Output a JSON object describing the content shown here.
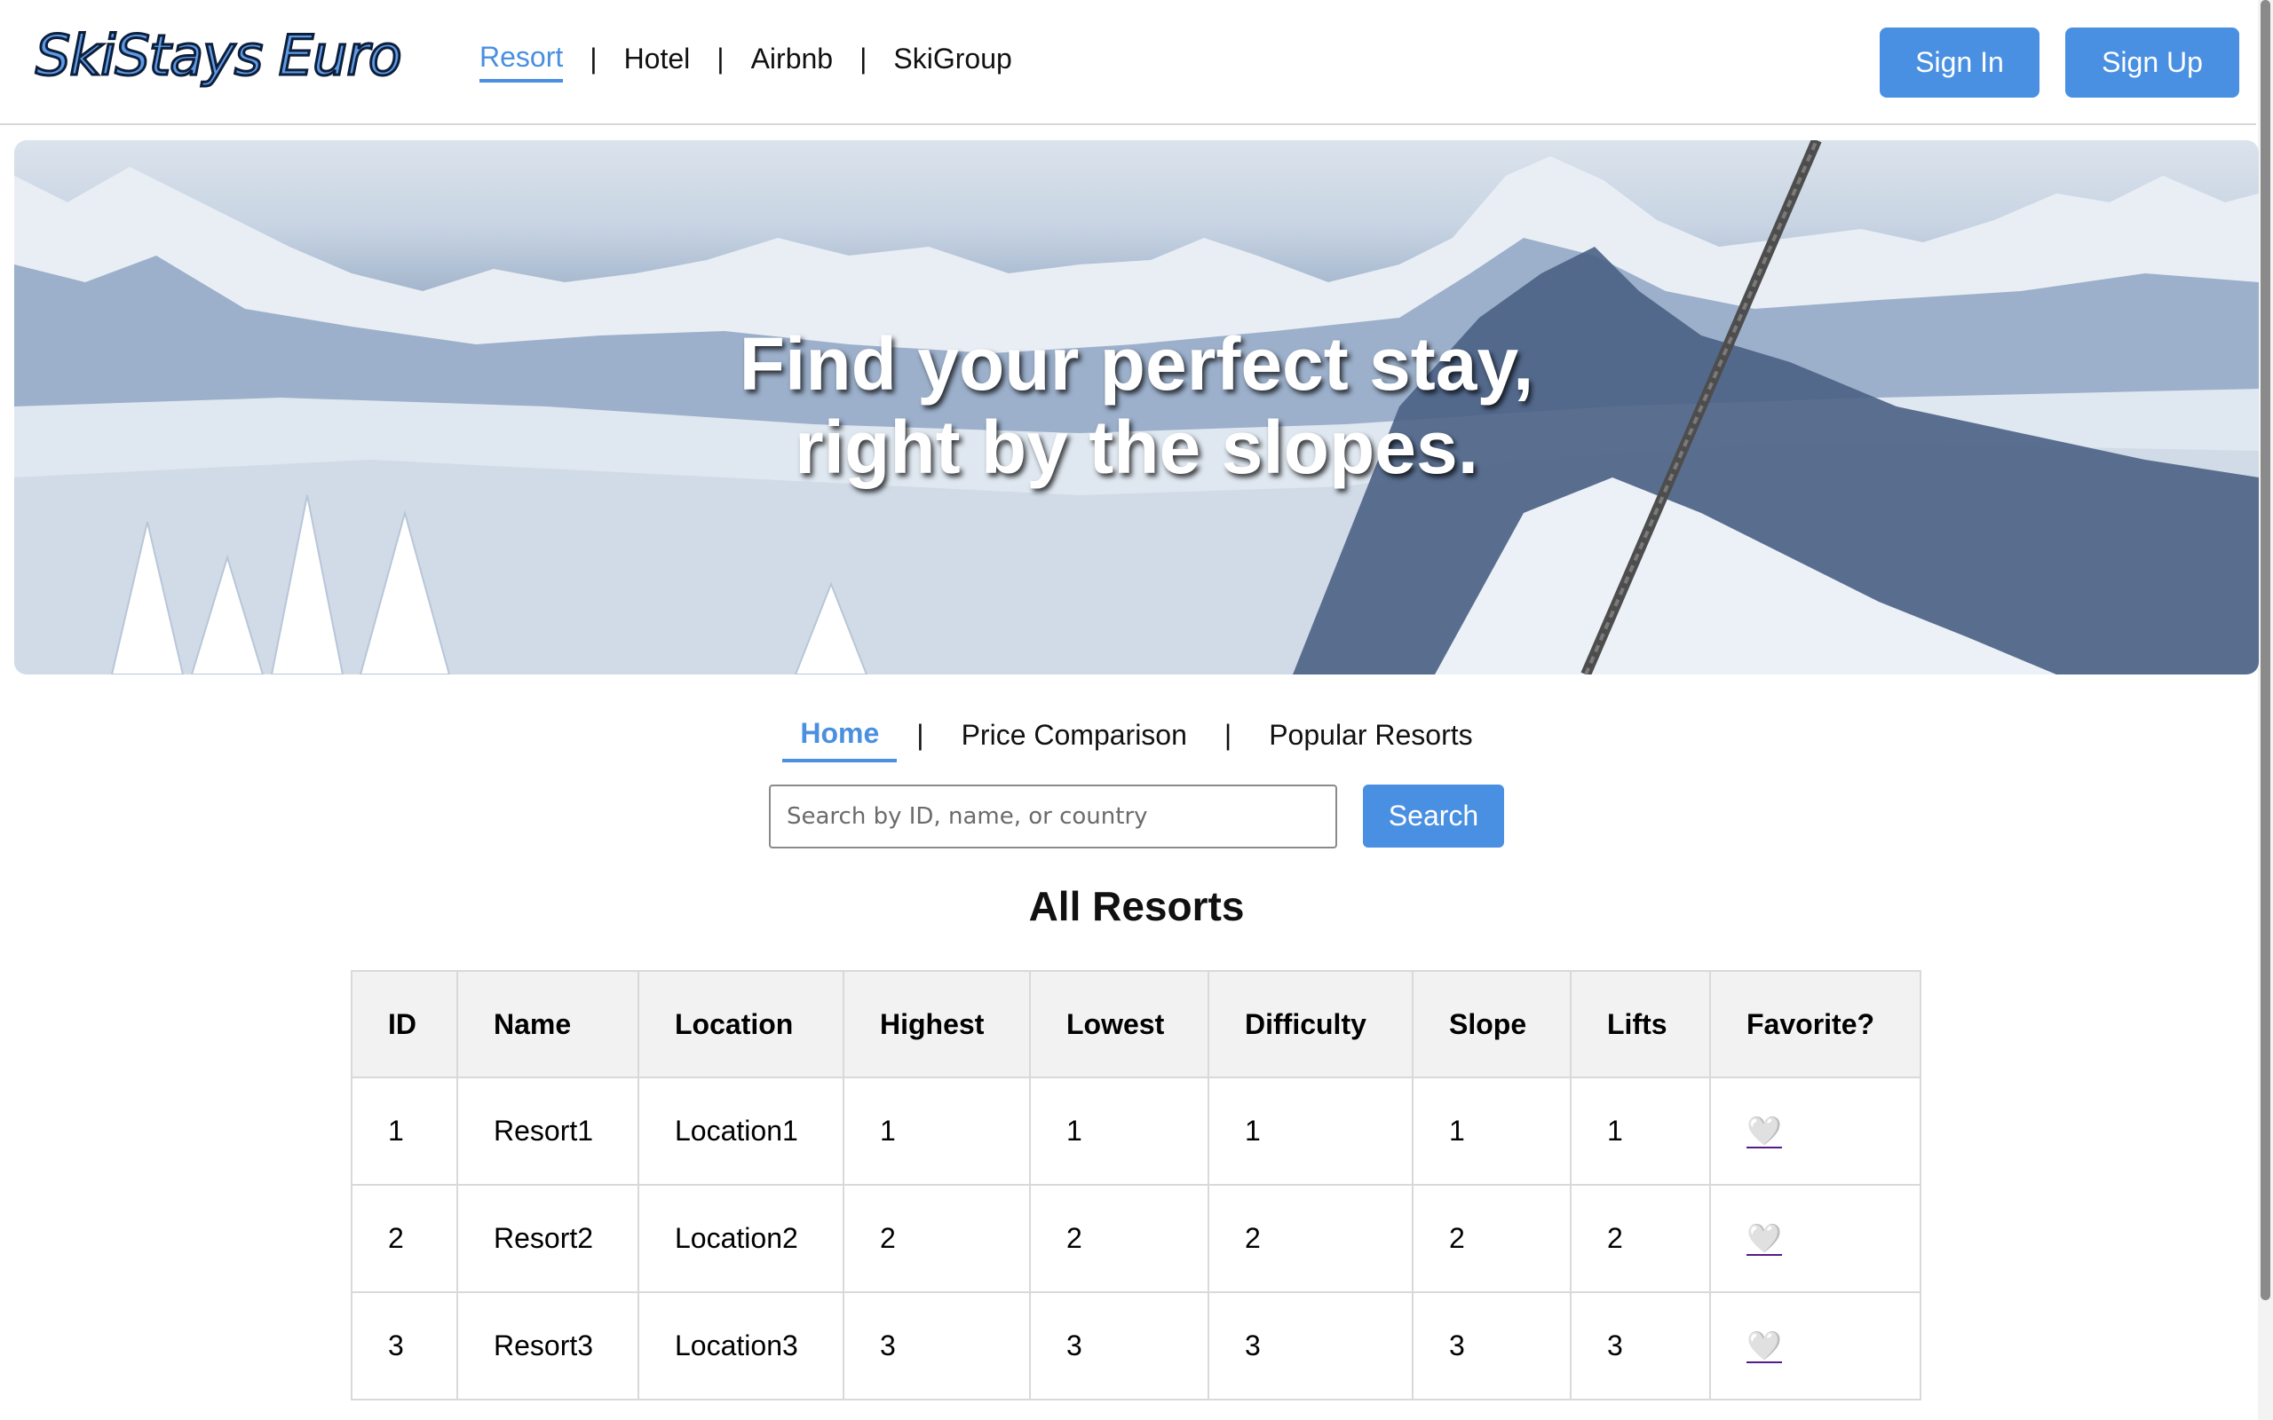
{
  "brand": {
    "logo_text": "SkiStays Euro"
  },
  "top_nav": {
    "items": [
      {
        "label": "Resort",
        "active": true
      },
      {
        "label": "Hotel",
        "active": false
      },
      {
        "label": "Airbnb",
        "active": false
      },
      {
        "label": "SkiGroup",
        "active": false
      }
    ],
    "separator": "|"
  },
  "auth": {
    "sign_in_label": "Sign In",
    "sign_up_label": "Sign Up"
  },
  "hero": {
    "line1": "Find your perfect stay,",
    "line2": "right by the slopes."
  },
  "sub_nav": {
    "items": [
      {
        "label": "Home",
        "active": true
      },
      {
        "label": "Price Comparison",
        "active": false
      },
      {
        "label": "Popular Resorts",
        "active": false
      }
    ],
    "separator": "|"
  },
  "search": {
    "placeholder": "Search by ID, name, or country",
    "value": "",
    "button_label": "Search"
  },
  "section_title": "All Resorts",
  "table": {
    "columns": [
      "ID",
      "Name",
      "Location",
      "Highest",
      "Lowest",
      "Difficulty",
      "Slope",
      "Lifts",
      "Favorite?"
    ],
    "rows": [
      {
        "id": "1",
        "name": "Resort1",
        "location": "Location1",
        "highest": "1",
        "lowest": "1",
        "difficulty": "1",
        "slope": "1",
        "lifts": "1",
        "favorite_icon": "🤍"
      },
      {
        "id": "2",
        "name": "Resort2",
        "location": "Location2",
        "highest": "2",
        "lowest": "2",
        "difficulty": "2",
        "slope": "2",
        "lifts": "2",
        "favorite_icon": "🤍"
      },
      {
        "id": "3",
        "name": "Resort3",
        "location": "Location3",
        "highest": "3",
        "lowest": "3",
        "difficulty": "3",
        "slope": "3",
        "lifts": "3",
        "favorite_icon": "🤍"
      }
    ]
  },
  "colors": {
    "accent": "#4a90e2",
    "active_link": "#4a8fe0",
    "table_header_bg": "#f2f2f2",
    "border": "#d9d9d9"
  }
}
